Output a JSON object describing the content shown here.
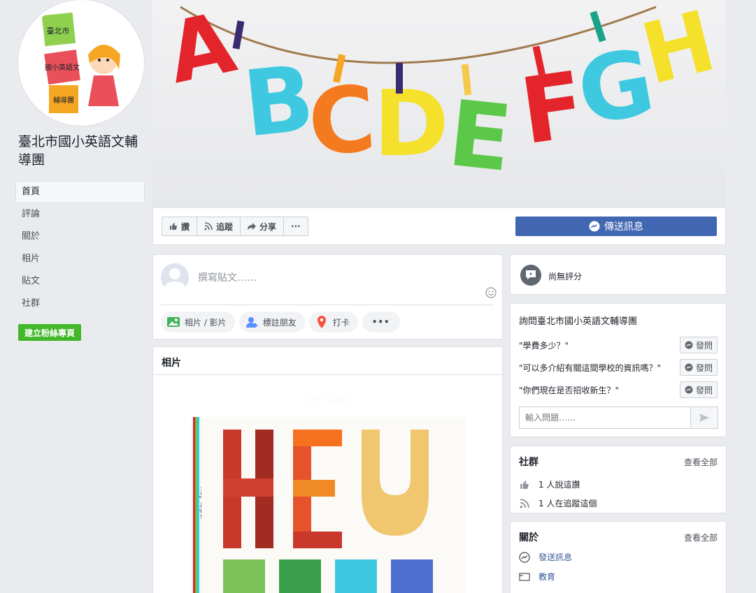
{
  "page": {
    "name": "臺北市國小英語文輔導團"
  },
  "logo": {
    "box1": "臺北市",
    "box2": "國小英語文",
    "box3": "輔導團"
  },
  "nav": {
    "items": [
      {
        "label": "首頁"
      },
      {
        "label": "評論"
      },
      {
        "label": "關於"
      },
      {
        "label": "相片"
      },
      {
        "label": "貼文"
      },
      {
        "label": "社群"
      }
    ],
    "active_index": 0
  },
  "create_page_button": "建立粉絲專頁",
  "cover": {
    "letters": [
      "A",
      "B",
      "C",
      "D",
      "E",
      "F",
      "G",
      "H"
    ]
  },
  "actions": {
    "like": "讚",
    "follow": "追蹤",
    "share": "分享",
    "more": "···",
    "send_message": "傳送訊息"
  },
  "composer": {
    "placeholder": "撰寫貼文……",
    "photo_video": "相片 / 影片",
    "tag_friends": "標註朋友",
    "check_in": "打卡",
    "more": "•••"
  },
  "photos": {
    "title": "相片",
    "book_title": "HEY TAIPEI",
    "spine_text": "Hey Taipei"
  },
  "rating": {
    "text": "尚無評分"
  },
  "ask": {
    "title": "詢問臺北市國小英語文輔導團",
    "questions": [
      {
        "text": "\"學費多少？\"",
        "button": "發問"
      },
      {
        "text": "\"可以多介紹有關這間學校的資訊嗎？\"",
        "button": "發問"
      },
      {
        "text": "\"你們現在是否招收新生？\"",
        "button": "發問"
      }
    ],
    "input_placeholder": "輸入問題……"
  },
  "community": {
    "title": "社群",
    "see_all": "查看全部",
    "likes": "1 人說這讚",
    "follows": "1 人在追蹤這個"
  },
  "about": {
    "title": "關於",
    "see_all": "查看全部",
    "send_message": "發送訊息",
    "category": "教育"
  },
  "colors": {
    "accent": "#4267b2",
    "create_green": "#42b72a"
  }
}
